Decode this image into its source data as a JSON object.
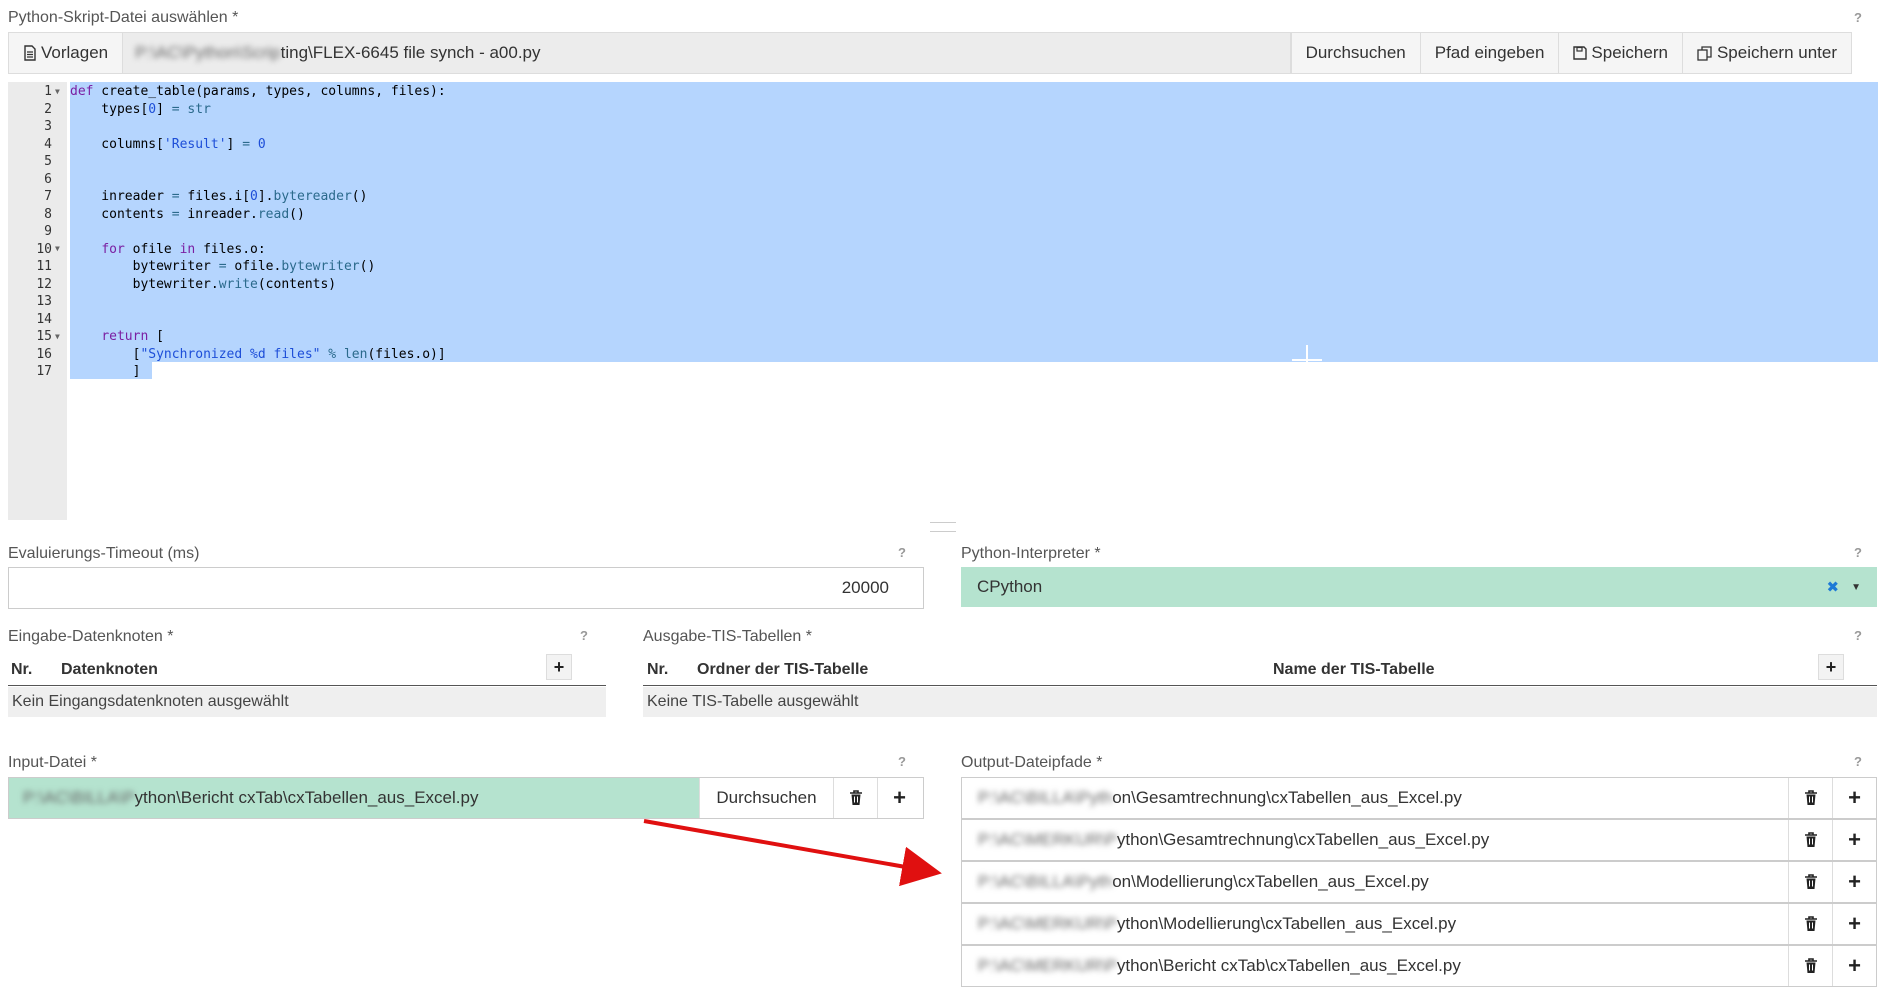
{
  "script_section": {
    "label": "Python-Skript-Datei auswählen *",
    "help": "?",
    "templates_button": "Vorlagen",
    "path_blurred": "P:\\AC\\Python\\Scrip",
    "path_visible": "ting\\FLEX-6645 file synch - a00.py",
    "browse_button": "Durchsuchen",
    "enter_path_button": "Pfad eingeben",
    "save_button": "Speichern",
    "save_as_button": "Speichern unter"
  },
  "code_lines": [
    "1",
    "2",
    "3",
    "4",
    "5",
    "6",
    "7",
    "8",
    "9",
    "10",
    "11",
    "12",
    "13",
    "14",
    "15",
    "16",
    "17"
  ],
  "timeout": {
    "label": "Evaluierungs-Timeout (ms)",
    "help": "?",
    "value": "20000"
  },
  "interpreter": {
    "label": "Python-Interpreter *",
    "help": "?",
    "value": "CPython",
    "clear": "✖"
  },
  "input_nodes": {
    "label": "Eingabe-Datenknoten *",
    "help": "?",
    "col_nr": "Nr.",
    "col_node": "Datenknoten",
    "empty": "Kein Eingangsdatenknoten ausgewählt"
  },
  "output_tables": {
    "label": "Ausgabe-TIS-Tabellen *",
    "help": "?",
    "col_nr": "Nr.",
    "col_folder": "Ordner der TIS-Tabelle",
    "col_name": "Name der TIS-Tabelle",
    "empty": "Keine TIS-Tabelle ausgewählt"
  },
  "input_file": {
    "label": "Input-Datei *",
    "help": "?",
    "path_blurred": "P:\\AC\\BILLA\\P",
    "path_visible": "ython\\Bericht cxTab\\cxTabellen_aus_Excel.py",
    "browse_button": "Durchsuchen"
  },
  "output_paths": {
    "label": "Output-Dateipfade *",
    "help": "?",
    "rows": [
      {
        "blurred": "P:\\AC\\BILLA\\Pyth",
        "visible": "on\\Gesamtrechnung\\cxTabellen_aus_Excel.py"
      },
      {
        "blurred": "P:\\AC\\MERKUR\\P",
        "visible": "ython\\Gesamtrechnung\\cxTabellen_aus_Excel.py"
      },
      {
        "blurred": "P:\\AC\\BILLA\\Pyth",
        "visible": "on\\Modellierung\\cxTabellen_aus_Excel.py"
      },
      {
        "blurred": "P:\\AC\\MERKUR\\P",
        "visible": "ython\\Modellierung\\cxTabellen_aus_Excel.py"
      },
      {
        "blurred": "P:\\AC\\MERKUR\\P",
        "visible": "ython\\Bericht cxTab\\cxTabellen_aus_Excel.py"
      }
    ]
  },
  "colors": {
    "selection": "#b5d5fe",
    "green_field": "#b5e3cf",
    "arrow": "#e01010"
  }
}
